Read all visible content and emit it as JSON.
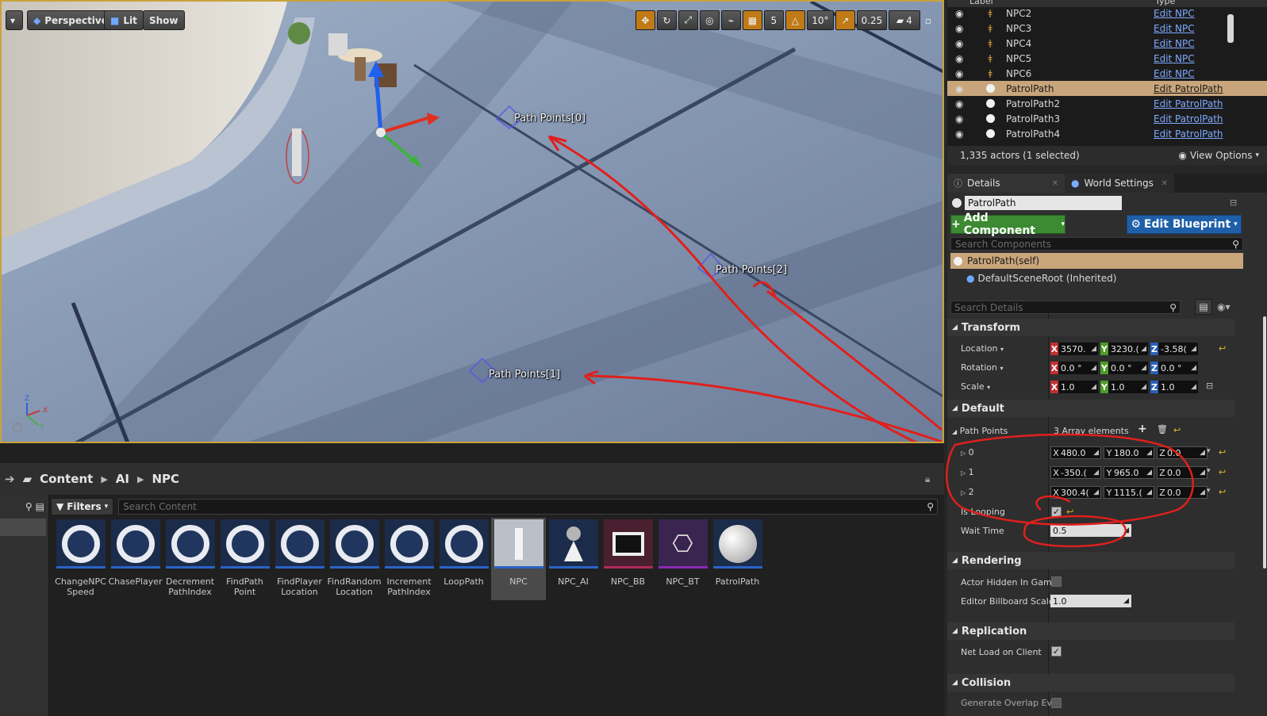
{
  "viewport": {
    "view_mode": "Perspective",
    "lit_mode": "Lit",
    "show_label": "Show",
    "grid_snap": "5",
    "rotation_snap": "10°",
    "scale_snap": "0.25",
    "camera_speed": "4",
    "path_labels": [
      "Path Points[0]",
      "Path Points[2]",
      "Path Points[1]"
    ],
    "axis_labels": [
      "Z",
      "X",
      "Y"
    ],
    "annotation_color": "#e0201c"
  },
  "content_browser": {
    "breadcrumb": [
      "Content",
      "AI",
      "NPC"
    ],
    "filters_label": "Filters",
    "search_placeholder": "Search Content",
    "assets": [
      {
        "label": "ChangeNPC Speed",
        "type": "task",
        "strip": "#2a63c5"
      },
      {
        "label": "ChasePlayer",
        "type": "task",
        "strip": "#2a63c5"
      },
      {
        "label": "Decrement PathIndex",
        "type": "task",
        "strip": "#2a63c5"
      },
      {
        "label": "FindPath Point",
        "type": "task",
        "strip": "#2a63c5"
      },
      {
        "label": "FindPlayer Location",
        "type": "task",
        "strip": "#2a63c5"
      },
      {
        "label": "FindRandom Location",
        "type": "task",
        "strip": "#2a63c5"
      },
      {
        "label": "Increment PathIndex",
        "type": "task",
        "strip": "#2a63c5"
      },
      {
        "label": "LoopPath",
        "type": "task",
        "strip": "#2a63c5"
      },
      {
        "label": "NPC",
        "type": "character",
        "strip": "#2a63c5"
      },
      {
        "label": "NPC_AI",
        "type": "controller",
        "strip": "#2a63c5"
      },
      {
        "label": "NPC_BB",
        "type": "blackboard",
        "strip": "#b02a5a"
      },
      {
        "label": "NPC_BT",
        "type": "behavior-tree",
        "strip": "#8a2ab5"
      },
      {
        "label": "PatrolPath",
        "type": "sphere",
        "strip": "#2a63c5"
      }
    ]
  },
  "outliner": {
    "header_label": "Label",
    "header_type": "Type",
    "rows": [
      {
        "label": "NPC2",
        "type": "Edit NPC",
        "icon": "npc"
      },
      {
        "label": "NPC3",
        "type": "Edit NPC",
        "icon": "npc"
      },
      {
        "label": "NPC4",
        "type": "Edit NPC",
        "icon": "npc"
      },
      {
        "label": "NPC5",
        "type": "Edit NPC",
        "icon": "npc"
      },
      {
        "label": "NPC6",
        "type": "Edit NPC",
        "icon": "npc"
      },
      {
        "label": "PatrolPath",
        "type": "Edit PatrolPath",
        "icon": "sphere",
        "selected": true
      },
      {
        "label": "PatrolPath2",
        "type": "Edit PatrolPath",
        "icon": "sphere"
      },
      {
        "label": "PatrolPath3",
        "type": "Edit PatrolPath",
        "icon": "sphere"
      },
      {
        "label": "PatrolPath4",
        "type": "Edit PatrolPath",
        "icon": "sphere"
      }
    ],
    "status": "1,335 actors (1 selected)",
    "view_options": "View Options"
  },
  "details": {
    "tab_details": "Details",
    "tab_world": "World Settings",
    "actor_name": "PatrolPath",
    "add_component": "Add Component",
    "edit_blueprint": "Edit Blueprint",
    "search_components": "Search Components",
    "component_self": "PatrolPath(self)",
    "component_root": "DefaultSceneRoot (Inherited)",
    "search_details": "Search Details",
    "transform": {
      "title": "Transform",
      "location_label": "Location",
      "location": {
        "x": "3570.",
        "y": "3230.(",
        "z": "-3.58("
      },
      "rotation_label": "Rotation",
      "rotation": {
        "x": "0.0 °",
        "y": "0.0 °",
        "z": "0.0 °"
      },
      "scale_label": "Scale",
      "scale": {
        "x": "1.0",
        "y": "1.0",
        "z": "1.0"
      }
    },
    "default": {
      "title": "Default",
      "path_points_label": "Path Points",
      "path_points_count": "3 Array elements",
      "points": [
        {
          "index": "0",
          "x": "480.0",
          "y": "180.0",
          "z": "0.0"
        },
        {
          "index": "1",
          "x": "-350.(",
          "y": "965.0",
          "z": "0.0"
        },
        {
          "index": "2",
          "x": "300.4(",
          "y": "1115.(",
          "z": "0.0"
        }
      ],
      "is_looping_label": "Is Looping",
      "is_looping": true,
      "wait_time_label": "Wait Time",
      "wait_time": "0.5"
    },
    "rendering": {
      "title": "Rendering",
      "hidden_label": "Actor Hidden In Game",
      "billboard_label": "Editor Billboard Scale",
      "billboard_value": "1.0"
    },
    "replication": {
      "title": "Replication",
      "net_load_label": "Net Load on Client"
    },
    "collision": {
      "title": "Collision",
      "overlap_label": "Generate Overlap Ever"
    }
  }
}
